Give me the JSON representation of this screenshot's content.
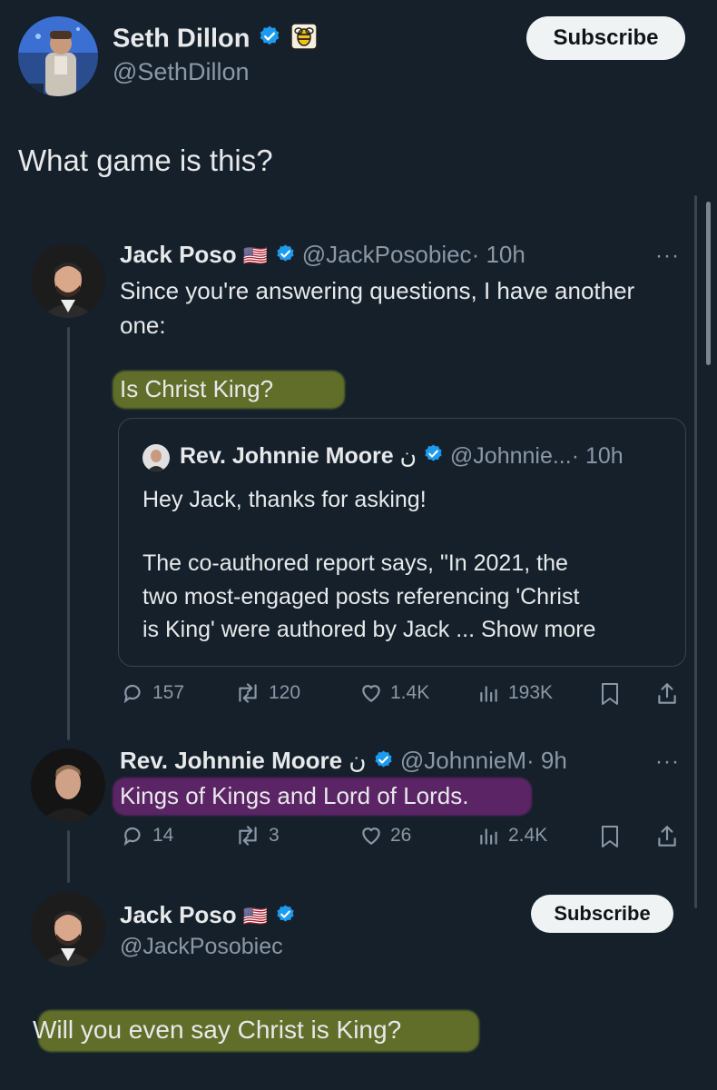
{
  "main_post": {
    "author_name": "Seth Dillon",
    "author_handle": "@SethDillon",
    "subscribe_label": "Subscribe",
    "text": "What game is this?"
  },
  "quoted_post": {
    "author_name": "Jack Poso",
    "flag": "🇺🇸",
    "author_handle": "@JackPosobiec",
    "time": "· 10h",
    "text_line1": "Since you're answering questions, I have another",
    "text_line2": "one:",
    "text_highlight": "Is Christ King?",
    "more_label": "···",
    "inner_quote": {
      "author_name": "Rev. Johnnie Moore",
      "arabic_glyph": "ن",
      "author_handle": "@Johnnie...",
      "time": "· 10h",
      "line1": "Hey Jack, thanks for asking!",
      "line2": "The co-authored report says, \"In 2021, the",
      "line3": "two most-engaged posts referencing 'Christ",
      "line4": "is King' were authored by Jack ... Show more"
    },
    "replies": "157",
    "reposts": "120",
    "likes": "1.4K",
    "views": "193K"
  },
  "reply_post": {
    "author_name": "Rev. Johnnie Moore",
    "arabic_glyph": "ن",
    "author_handle": "@JohnnieM",
    "time": "· 9h",
    "text": "Kings of Kings and Lord of Lords.",
    "more_label": "···",
    "replies": "14",
    "reposts": "3",
    "likes": "26",
    "views": "2.4K"
  },
  "bottom_post": {
    "author_name": "Jack Poso",
    "flag": "🇺🇸",
    "author_handle": "@JackPosobiec",
    "subscribe_label": "Subscribe",
    "text": "Will you even say Christ is King?"
  },
  "colors": {
    "background": "#15202b",
    "verified_blue": "#1d9bf0",
    "muted": "#8b98a5",
    "highlight_yellow": "#a0af28",
    "highlight_pink": "#962896"
  }
}
